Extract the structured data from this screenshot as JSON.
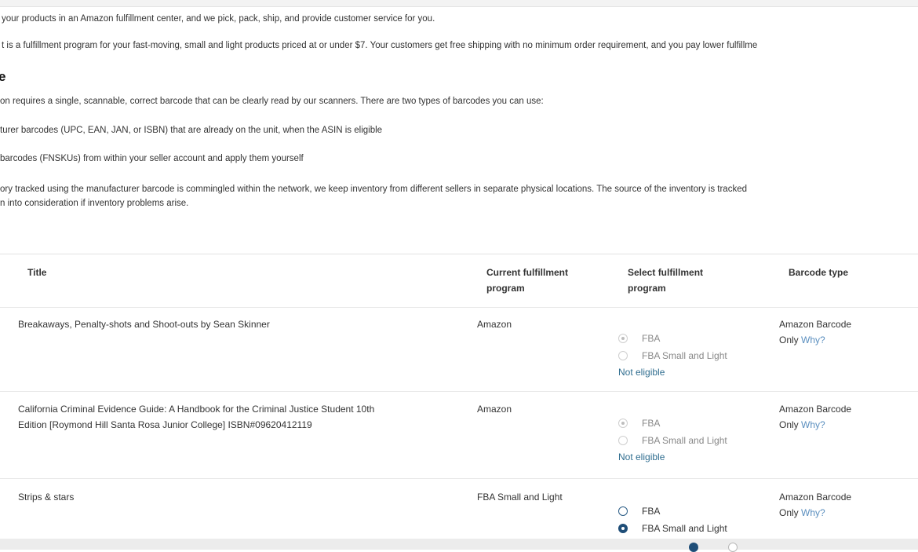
{
  "intro": {
    "fba_line": "your products in an Amazon fulfillment center, and we pick, pack, ship, and provide customer service for you.",
    "sl_line": "t is a fulfillment program for your fast-moving, small and light products priced at or under $7. Your customers get free shipping with no minimum order requirement, and you pay lower fulfillme",
    "heading": "e",
    "barcode_intro": "on requires a single, scannable, correct barcode that can be clearly read by our scanners. There are two types of barcodes you can use:",
    "bullet1": "turer barcodes (UPC, EAN, JAN, or ISBN) that are already on the unit, when the ASIN is eligible",
    "bullet2": "barcodes (FNSKUs) from within your seller account and apply them yourself",
    "note_line1": "ory tracked using the manufacturer barcode is commingled within the network, we keep inventory from different sellers in separate physical locations. The source of the inventory is tracked",
    "note_line2": "n into consideration if inventory problems arise."
  },
  "table": {
    "headers": {
      "title": "Title",
      "current_line1": "Current fulfillment",
      "current_line2": "program",
      "select_line1": "Select fulfillment",
      "select_line2": "program",
      "barcode": "Barcode type"
    },
    "rows": [
      {
        "title_line1": "Breakaways, Penalty-shots and Shoot-outs by Sean Skinner",
        "title_line2": "",
        "current": "Amazon",
        "option1": "FBA",
        "option2": "FBA Small and Light",
        "status": "Not eligible",
        "barcode_line1": "Amazon Barcode",
        "barcode_only": "Only",
        "barcode_why": "Why?"
      },
      {
        "title_line1": "California Criminal Evidence Guide: A Handbook for the Criminal Justice Student 10th",
        "title_line2": "Edition [Roymond Hill Santa Rosa Junior College] ISBN#09620412119",
        "current": "Amazon",
        "option1": "FBA",
        "option2": "FBA Small and Light",
        "status": "Not eligible",
        "barcode_line1": "Amazon Barcode",
        "barcode_only": "Only",
        "barcode_why": "Why?"
      },
      {
        "title_line1": "Strips & stars",
        "title_line2": "",
        "current": "FBA Small and Light",
        "option1": "FBA",
        "option2": "FBA Small and Light",
        "status": "",
        "barcode_line1": "Amazon Barcode",
        "barcode_only": "Only",
        "barcode_why": "Why?"
      }
    ]
  },
  "colors": {
    "link": "#2f6d8f",
    "why": "#5b8fbf",
    "selected_radio": "#1f4e78"
  }
}
